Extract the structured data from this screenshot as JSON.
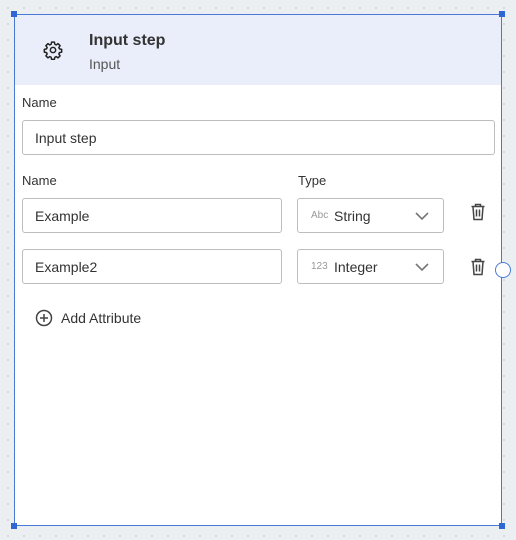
{
  "node": {
    "title": "Input step",
    "subtitle": "Input",
    "name_label": "Name",
    "name_value": "Input step"
  },
  "attributes": {
    "name_header": "Name",
    "type_header": "Type",
    "rows": [
      {
        "name": "Example",
        "type_prefix": "Abc",
        "type": "String"
      },
      {
        "name": "Example2",
        "type_prefix": "123",
        "type": "Integer"
      }
    ],
    "add_label": "Add Attribute"
  },
  "colors": {
    "header_bg": "#eaeefb",
    "selection": "#2f66d6",
    "canvas": "#eceff1"
  },
  "icons": {
    "header": "gear-icon",
    "dropdown": "chevron-down-icon",
    "delete": "trash-icon",
    "add": "add-circle-icon",
    "port": "connection-port"
  }
}
